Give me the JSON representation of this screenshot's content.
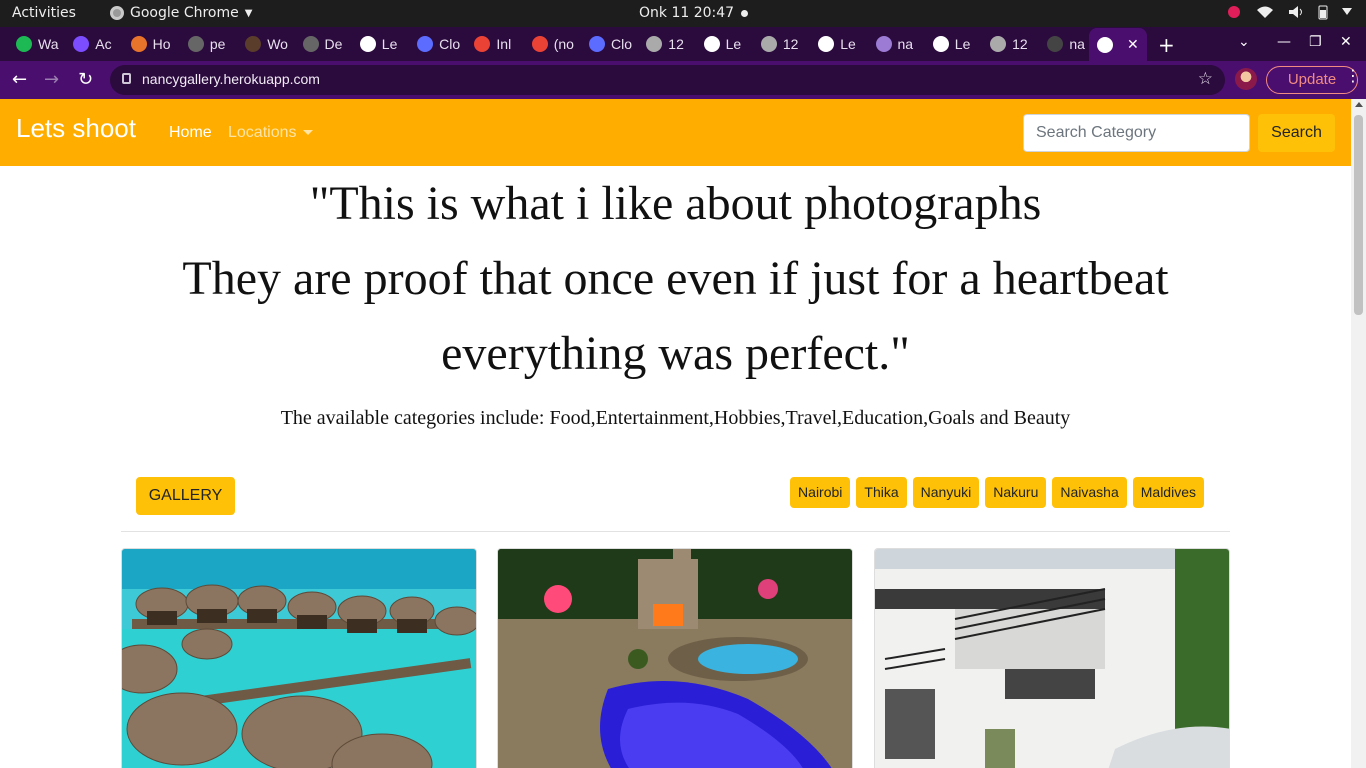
{
  "os_bar": {
    "activities": "Activities",
    "app_name": "Google Chrome",
    "clock": "Onk 11  20:47"
  },
  "tabs": [
    {
      "label": "Wa",
      "icon": "play-icon",
      "color": "#1db954"
    },
    {
      "label": "Ac",
      "icon": "circle-icon",
      "color": "#7c4dff"
    },
    {
      "label": "Ho",
      "icon": "flag-icon",
      "color": "#e8742b"
    },
    {
      "label": "pe",
      "icon": "github-icon",
      "color": "#666666"
    },
    {
      "label": "Wo",
      "icon": "tree-icon",
      "color": "#5a3d2b"
    },
    {
      "label": "De",
      "icon": "github-icon",
      "color": "#666666"
    },
    {
      "label": "Le",
      "icon": "globe-icon",
      "color": "#ffffff"
    },
    {
      "label": "Clo",
      "icon": "cloud-icon",
      "color": "#5b6cff"
    },
    {
      "label": "Inl",
      "icon": "gmail-icon",
      "color": "#ea4335"
    },
    {
      "label": "(no",
      "icon": "gmail-icon",
      "color": "#ea4335"
    },
    {
      "label": "Clo",
      "icon": "cloud-icon",
      "color": "#5b6cff"
    },
    {
      "label": "12",
      "icon": "globe-icon",
      "color": "#aaaaaa"
    },
    {
      "label": "Le",
      "icon": "globe-icon",
      "color": "#ffffff"
    },
    {
      "label": "12",
      "icon": "globe-icon",
      "color": "#aaaaaa"
    },
    {
      "label": "Le",
      "icon": "globe-icon",
      "color": "#ffffff"
    },
    {
      "label": "na",
      "icon": "heroku-icon",
      "color": "#9b7bd4"
    },
    {
      "label": "Le",
      "icon": "globe-icon",
      "color": "#ffffff"
    },
    {
      "label": "12",
      "icon": "globe-icon",
      "color": "#aaaaaa"
    },
    {
      "label": "na",
      "icon": "github-icon",
      "color": "#444444"
    }
  ],
  "browser": {
    "url": "nancygallery.herokuapp.com",
    "update_label": "Update"
  },
  "site": {
    "brand": "Lets shoot",
    "nav_home": "Home",
    "nav_locations": "Locations",
    "search_placeholder": "Search Category",
    "search_button": "Search",
    "quote_lines": [
      "\"This is what i like about photographs",
      "They are proof that once even if just for a heartbeat",
      "everything was perfect.\""
    ],
    "categories_text": "The available categories include: Food,Entertainment,Hobbies,Travel,Education,Goals and Beauty",
    "gallery_button": "GALLERY",
    "locations": [
      "Nairobi",
      "Thika",
      "Nanyuki",
      "Nakuru",
      "Naivasha",
      "Maldives"
    ]
  },
  "colors": {
    "navbar": "#ffae00",
    "button": "#ffc107",
    "tabstrip": "#2b0a3d",
    "toolbar": "#4a0f6e"
  }
}
